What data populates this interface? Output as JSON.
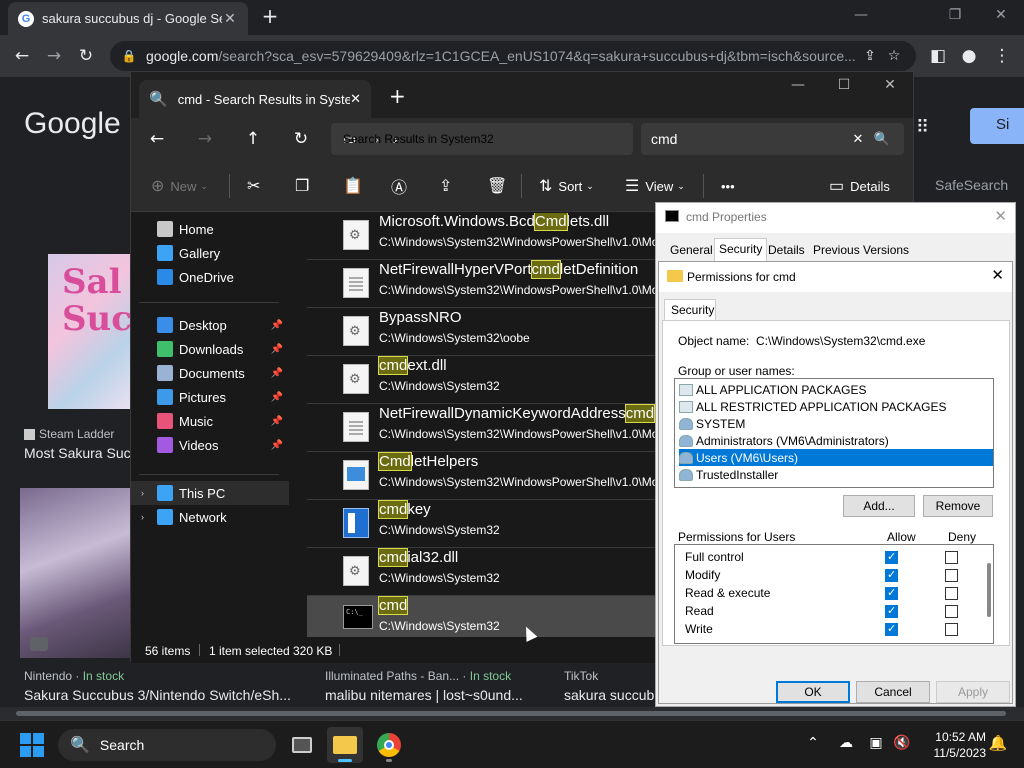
{
  "chrome": {
    "tab_title": "sakura succubus dj - Google Sea",
    "tab_close": "✕",
    "new_tab": "+",
    "win_min": "—",
    "win_max": "❐",
    "win_close": "✕",
    "url_host": "google.com",
    "url_path": "/search?sca_esv=579629409&rlz=1C1GCEA_enUS1074&q=sakura+succubus+dj&tbm=isch&source...",
    "icons": [
      "back-icon",
      "forward-icon",
      "reload-icon",
      "lock-icon",
      "share-icon",
      "star-icon",
      "sidepanel-icon",
      "profile-icon",
      "menu-icon"
    ]
  },
  "google_page": {
    "logo": "Google",
    "safesearch": "SafeSearch",
    "signin_label": "Si",
    "thumb1_text": "Sal Succ",
    "thumb1_source": "Steam Ladder",
    "thumb1_title": "Most Sakura Suc",
    "result_nintendo_source": "Nintendo",
    "result_nintendo_stock": "In stock",
    "result_nintendo_title": "Sakura Succubus 3/Nintendo Switch/eSh...",
    "result_illum_source": "Illuminated Paths - Ban...",
    "result_illum_stock": "In stock",
    "result_illum_title": "malibu nitemares | lost~s0und...",
    "result_tiktok_source": "TikTok",
    "result_tiktok_title": "sakura succub"
  },
  "explorer": {
    "tab_title": "cmd - Search Results in Systen",
    "breadcrumb_label": "Search Results in System32",
    "search_query": "cmd",
    "toolbar": {
      "new_label": "New",
      "sort_label": "Sort",
      "view_label": "View",
      "more_label": "•••",
      "details_label": "Details"
    },
    "nav": [
      {
        "label": "Home",
        "icon": "home-icon",
        "pinned": false
      },
      {
        "label": "Gallery",
        "icon": "gallery-icon",
        "pinned": false
      },
      {
        "label": "OneDrive",
        "icon": "onedrive-icon",
        "pinned": false
      },
      {
        "label": "Desktop",
        "icon": "desktop-icon",
        "pinned": true
      },
      {
        "label": "Downloads",
        "icon": "downloads-icon",
        "pinned": true
      },
      {
        "label": "Documents",
        "icon": "documents-icon",
        "pinned": true
      },
      {
        "label": "Pictures",
        "icon": "pictures-icon",
        "pinned": true
      },
      {
        "label": "Music",
        "icon": "music-icon",
        "pinned": true
      },
      {
        "label": "Videos",
        "icon": "videos-icon",
        "pinned": true
      },
      {
        "label": "This PC",
        "icon": "this-pc-icon",
        "pinned": false
      },
      {
        "label": "Network",
        "icon": "network-icon",
        "pinned": false
      }
    ],
    "files": [
      {
        "pre": "Microsoft.Windows.Bcd",
        "hl": "Cmd",
        "post": "lets.dll",
        "path": "C:\\Windows\\System32\\WindowsPowerShell\\v1.0\\Mo",
        "icon": "gear"
      },
      {
        "pre": "NetFirewallHyperVPort",
        "hl": "cmd",
        "post": "letDefinition",
        "path": "C:\\Windows\\System32\\WindowsPowerShell\\v1.0\\Mo",
        "icon": "doc"
      },
      {
        "pre": "BypassNRO",
        "hl": "",
        "post": "",
        "path": "C:\\Windows\\System32\\oobe",
        "icon": "gear"
      },
      {
        "pre": "",
        "hl": "cmd",
        "post": "ext.dll",
        "path": "C:\\Windows\\System32",
        "icon": "gear"
      },
      {
        "pre": "NetFirewallDynamicKeywordAddress",
        "hl": "cmd",
        "post": "",
        "path": "C:\\Windows\\System32\\WindowsPowerShell\\v1.0\\Mo",
        "icon": "doc"
      },
      {
        "pre": "",
        "hl": "Cmd",
        "post": "letHelpers",
        "path": "C:\\Windows\\System32\\WindowsPowerShell\\v1.0\\Mo",
        "icon": "help"
      },
      {
        "pre": "",
        "hl": "cmd",
        "post": "key",
        "path": "C:\\Windows\\System32",
        "icon": "blue"
      },
      {
        "pre": "",
        "hl": "cmd",
        "post": "ial32.dll",
        "path": "C:\\Windows\\System32",
        "icon": "gear"
      },
      {
        "pre": "",
        "hl": "cmd",
        "post": "",
        "path": "C:\\Windows\\System32",
        "icon": "cmd"
      }
    ],
    "status_items": "56 items",
    "status_selected": "1 item selected",
    "status_size": "320 KB"
  },
  "properties": {
    "title": "cmd Properties",
    "tabs": [
      "General",
      "Security",
      "Details",
      "Previous Versions"
    ],
    "perm_title": "Permissions for cmd",
    "security_tab": "Security",
    "object_name_label": "Object name:",
    "object_name_value": "C:\\Windows\\System32\\cmd.exe",
    "group_label": "Group or user names:",
    "groups": [
      {
        "name": "ALL APPLICATION PACKAGES",
        "kind": "group"
      },
      {
        "name": "ALL RESTRICTED APPLICATION PACKAGES",
        "kind": "group"
      },
      {
        "name": "SYSTEM",
        "kind": "user"
      },
      {
        "name": "Administrators (VM6\\Administrators)",
        "kind": "user"
      },
      {
        "name": "Users (VM6\\Users)",
        "kind": "user"
      },
      {
        "name": "TrustedInstaller",
        "kind": "user"
      }
    ],
    "selected_group_index": 4,
    "add_label": "Add...",
    "remove_label": "Remove",
    "perms_label": "Permissions for Users",
    "allow_label": "Allow",
    "deny_label": "Deny",
    "permissions": [
      {
        "name": "Full control",
        "allow": true,
        "deny": false
      },
      {
        "name": "Modify",
        "allow": true,
        "deny": false
      },
      {
        "name": "Read & execute",
        "allow": true,
        "deny": false
      },
      {
        "name": "Read",
        "allow": true,
        "deny": false
      },
      {
        "name": "Write",
        "allow": true,
        "deny": false
      }
    ],
    "ok_label": "OK",
    "cancel_label": "Cancel",
    "apply_label": "Apply"
  },
  "taskbar": {
    "search_label": "Search",
    "time": "10:52 AM",
    "date": "11/5/2023"
  },
  "colors": {
    "accent": "#0078d7",
    "highlight": "#6b6b12",
    "chrome_bg": "#202124"
  }
}
